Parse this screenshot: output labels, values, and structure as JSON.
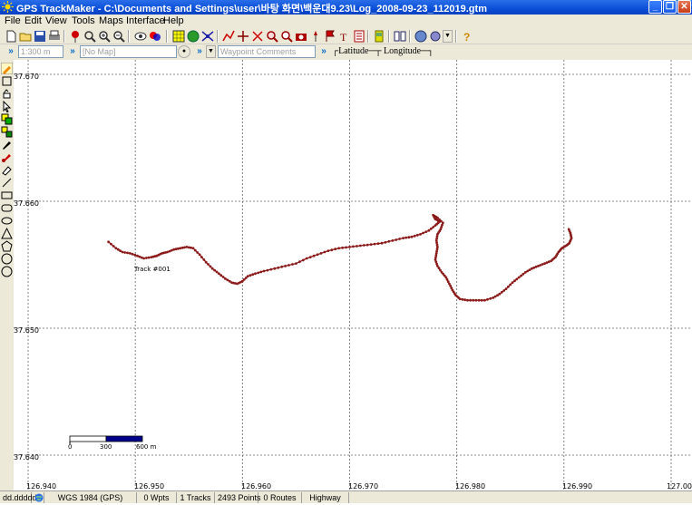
{
  "window": {
    "title": "GPS TrackMaker - C:\\Documents and Settings\\user\\바탕 화면\\백운대9.23\\Log_2008-09-23_112019.gtm",
    "minimize": "_",
    "maximize": "❐",
    "close": "✕"
  },
  "menu": [
    "File",
    "Edit",
    "View",
    "Tools",
    "Maps",
    "Interface",
    "Help"
  ],
  "toolbar2": {
    "scale_value": "1:300 m",
    "map_value": "[No Map]",
    "waypoint_placeholder": "Waypoint Comments",
    "latitude_label": "Latitude",
    "longitude_label": "Longitude"
  },
  "map": {
    "lat_labels": [
      "37.670",
      "37.660",
      "37.650",
      "37.640"
    ],
    "lon_labels": [
      "126.940",
      "126.950",
      "126.960",
      "126.970",
      "126.980",
      "126.990",
      "127.000"
    ],
    "track_label": "Track #001",
    "track_color": "#8b1a1a",
    "scalebar": {
      "labels": [
        "0",
        "300",
        "600 m"
      ]
    }
  },
  "track": [
    [
      126.9475,
      37.6568
    ],
    [
      126.9482,
      37.6563
    ],
    [
      126.9488,
      37.656
    ],
    [
      126.9495,
      37.6559
    ],
    [
      126.9502,
      37.6557
    ],
    [
      126.9508,
      37.6555
    ],
    [
      126.9515,
      37.6556
    ],
    [
      126.952,
      37.6557
    ],
    [
      126.9525,
      37.6559
    ],
    [
      126.953,
      37.656
    ],
    [
      126.9536,
      37.6562
    ],
    [
      126.9542,
      37.6563
    ],
    [
      126.9548,
      37.6564
    ],
    [
      126.9554,
      37.6563
    ],
    [
      126.956,
      37.6558
    ],
    [
      126.9566,
      37.6552
    ],
    [
      126.9572,
      37.6547
    ],
    [
      126.9578,
      37.6543
    ],
    [
      126.9584,
      37.6539
    ],
    [
      126.959,
      37.6536
    ],
    [
      126.9595,
      37.6535
    ],
    [
      126.96,
      37.6537
    ],
    [
      126.9605,
      37.6541
    ],
    [
      126.9612,
      37.6543
    ],
    [
      126.962,
      37.6545
    ],
    [
      126.963,
      37.6547
    ],
    [
      126.964,
      37.6549
    ],
    [
      126.965,
      37.6551
    ],
    [
      126.966,
      37.6555
    ],
    [
      126.967,
      37.6558
    ],
    [
      126.968,
      37.6561
    ],
    [
      126.969,
      37.6563
    ],
    [
      126.97,
      37.6564
    ],
    [
      126.971,
      37.6565
    ],
    [
      126.972,
      37.6566
    ],
    [
      126.973,
      37.6567
    ],
    [
      126.974,
      37.6569
    ],
    [
      126.975,
      37.6571
    ],
    [
      126.9758,
      37.6572
    ],
    [
      126.9766,
      37.6574
    ],
    [
      126.9774,
      37.6577
    ],
    [
      126.978,
      37.6581
    ],
    [
      126.9784,
      37.6584
    ],
    [
      126.978,
      37.6586
    ],
    [
      126.9778,
      37.6589
    ],
    [
      126.9782,
      37.6587
    ],
    [
      126.9787,
      37.6583
    ],
    [
      126.9785,
      37.6578
    ],
    [
      126.9782,
      37.6574
    ],
    [
      126.9781,
      37.6569
    ],
    [
      126.9782,
      37.6564
    ],
    [
      126.9781,
      37.6559
    ],
    [
      126.978,
      37.6554
    ],
    [
      126.9782,
      37.6549
    ],
    [
      126.9786,
      37.6544
    ],
    [
      126.979,
      37.654
    ],
    [
      126.9793,
      37.6535
    ],
    [
      126.9796,
      37.653
    ],
    [
      126.9799,
      37.6526
    ],
    [
      126.9803,
      37.6523
    ],
    [
      126.981,
      37.6522
    ],
    [
      126.9818,
      37.6522
    ],
    [
      126.9826,
      37.6522
    ],
    [
      126.9834,
      37.6524
    ],
    [
      126.984,
      37.6527
    ],
    [
      126.9846,
      37.6531
    ],
    [
      126.9852,
      37.6536
    ],
    [
      126.9858,
      37.654
    ],
    [
      126.9864,
      37.6544
    ],
    [
      126.987,
      37.6547
    ],
    [
      126.9876,
      37.6549
    ],
    [
      126.9882,
      37.6551
    ],
    [
      126.9888,
      37.6553
    ],
    [
      126.9892,
      37.6556
    ],
    [
      126.9895,
      37.656
    ],
    [
      126.9898,
      37.6563
    ],
    [
      126.9902,
      37.6565
    ],
    [
      126.9905,
      37.6567
    ],
    [
      126.9907,
      37.6571
    ],
    [
      126.9906,
      37.6575
    ],
    [
      126.9904,
      37.6579
    ]
  ]
}
